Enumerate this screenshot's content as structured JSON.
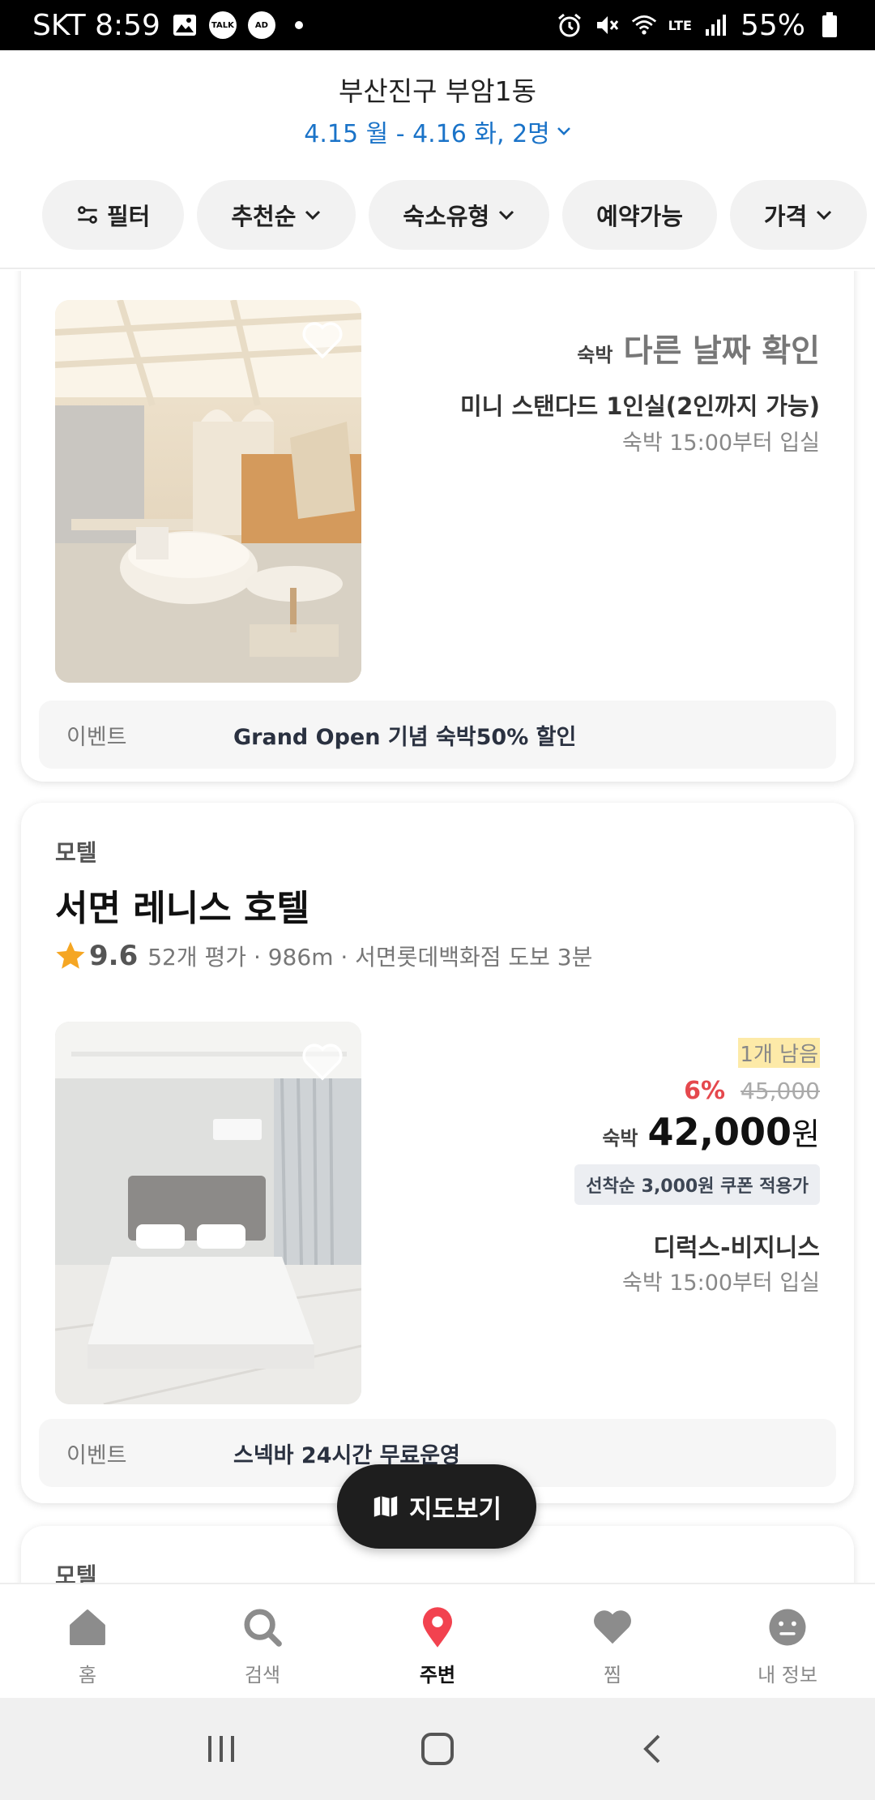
{
  "status_bar": {
    "carrier_time": "SKT 8:59",
    "talk": "TALK",
    "ad": "AD",
    "lte": "LTE",
    "battery": "55%"
  },
  "header": {
    "location": "부산진구 부암1동",
    "dates": "4.15 월 - 4.16 화, 2명"
  },
  "filters": {
    "filter": "필터",
    "sort": "추천순",
    "type": "숙소유형",
    "available": "예약가능",
    "price": "가격"
  },
  "listing1": {
    "stay_label": "숙박",
    "status": "다른 날짜 확인",
    "room_name": "미니 스탠다드 1인실(2인까지 가능)",
    "checkin": "숙박 15:00부터 입실",
    "event_label": "이벤트",
    "event_text": "Grand Open 기념 숙박50% 할인"
  },
  "listing2": {
    "category": "모텔",
    "name": "서면 레니스 호텔",
    "rating": "9.6",
    "meta": "52개 평가 · 986m · 서면롯데백화점 도보 3분",
    "remaining": "1개 남음",
    "discount": "6%",
    "original_price": "45,000",
    "stay_label": "숙박",
    "price": "42,000",
    "price_unit": "원",
    "coupon": "선착순 3,000원 쿠폰 적용가",
    "room_name": "디럭스-비지니스",
    "checkin": "숙박 15:00부터 입실",
    "event_label": "이벤트",
    "event_text": "스넥바 24시간 무료운영"
  },
  "listing3": {
    "category": "모텔"
  },
  "map_button": "지도보기",
  "bottom_nav": [
    {
      "label": "홈",
      "icon": "home-icon"
    },
    {
      "label": "검색",
      "icon": "search-icon"
    },
    {
      "label": "주변",
      "icon": "location-pin-icon"
    },
    {
      "label": "찜",
      "icon": "heart-icon"
    },
    {
      "label": "내 정보",
      "icon": "profile-icon"
    }
  ],
  "colors": {
    "accent_blue": "#1a73c8",
    "discount_red": "#e5484d",
    "pin_red": "#f2424f",
    "highlight_yellow": "#fdeaa8"
  }
}
